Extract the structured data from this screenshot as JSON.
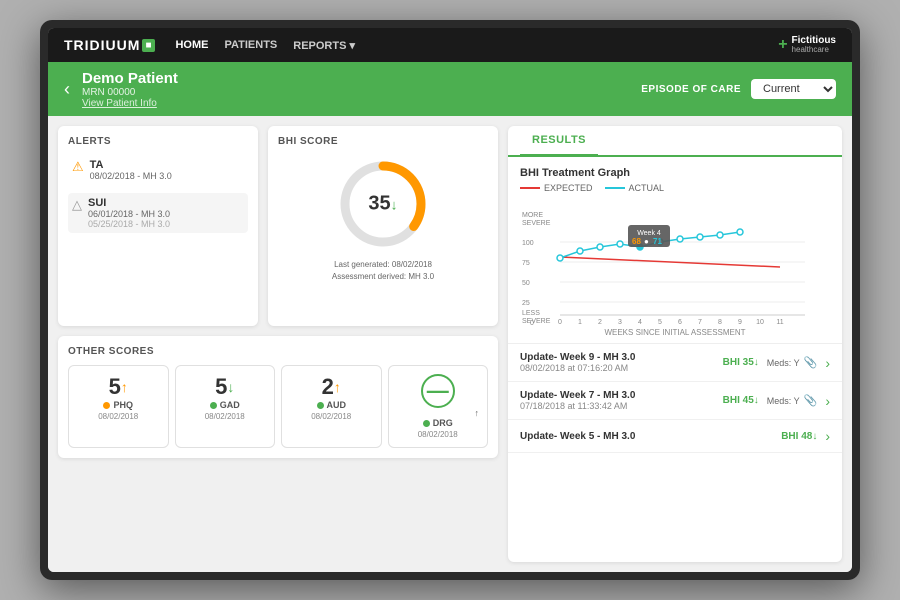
{
  "monitor": {
    "nav": {
      "logo": "TRIDIUUM",
      "logo_box": "■",
      "links": [
        {
          "label": "HOME",
          "active": true
        },
        {
          "label": "PATIENTS",
          "active": false
        },
        {
          "label": "REPORTS ▾",
          "active": false
        }
      ],
      "brand_plus": "+",
      "brand_name_top": "Fictitious",
      "brand_name_bottom": "healthcare"
    },
    "patient_header": {
      "back_label": "‹",
      "patient_name": "Demo Patient",
      "mrn": "MRN 00000",
      "view_info_link": "View Patient Info",
      "episode_label": "EPISODE OF CARE",
      "episode_value": "Current"
    },
    "alerts": {
      "title": "ALERTS",
      "items": [
        {
          "icon": "⚠",
          "icon_color": "#ff9800",
          "tag": "TA",
          "dates": [
            "08/02/2018 - MH 3.0"
          ],
          "highlighted": false
        },
        {
          "icon": "△",
          "icon_color": "#999",
          "tag": "SUI",
          "dates": [
            "06/01/2018 - MH 3.0",
            "05/25/2018 - MH 3.0"
          ],
          "highlighted": true
        }
      ]
    },
    "bhi_score": {
      "title": "BHI SCORE",
      "value": "35",
      "arrow": "↓",
      "donut_percent": 35,
      "meta_line1": "Last generated: 08/02/2018",
      "meta_line2": "Assessment derived: MH 3.0"
    },
    "other_scores": {
      "title": "OTHER SCORES",
      "scores": [
        {
          "value": "5",
          "arrow": "↑",
          "arrow_type": "up",
          "label": "PHQ",
          "dot_color": "#ff9800",
          "date": "08/02/2018"
        },
        {
          "value": "5",
          "arrow": "↓",
          "arrow_type": "down",
          "label": "GAD",
          "dot_color": "#4caf50",
          "date": "08/02/2018"
        },
        {
          "value": "2",
          "arrow": "↑",
          "arrow_type": "up",
          "label": "AUD",
          "dot_color": "#4caf50",
          "date": "08/02/2018"
        },
        {
          "value": "—",
          "arrow": "↑",
          "arrow_type": "up",
          "label": "DRG",
          "dot_color": "#4caf50",
          "date": "08/02/2018",
          "is_dash": true
        }
      ]
    },
    "results": {
      "tab_label": "RESULTS",
      "chart": {
        "title": "BHI Treatment Graph",
        "legend_expected": "EXPECTED",
        "legend_actual": "ACTUAL",
        "y_label_top": "MORE\nSEVERE",
        "y_label_bottom": "LESS\nSEVERE",
        "y_max": 100,
        "x_label": "WEEKS SINCE INITIAL ASSESSMENT",
        "tooltip_week": "Week 4",
        "tooltip_68": "68",
        "tooltip_71": "71"
      },
      "entries": [
        {
          "title": "Update- Week 9 - MH 3.0",
          "date": "08/02/2018 at 07:16:20 AM",
          "bhi": "BHI 35",
          "bhi_arrow": "↓",
          "meds": "Meds: Y"
        },
        {
          "title": "Update- Week 7 - MH 3.0",
          "date": "07/18/2018 at 11:33:42 AM",
          "bhi": "BHI 45",
          "bhi_arrow": "↓",
          "meds": "Meds: Y"
        },
        {
          "title": "Update- Week 5 - MH 3.0",
          "date": "",
          "bhi": "BHI 48",
          "bhi_arrow": "↓",
          "meds": ""
        }
      ]
    }
  }
}
